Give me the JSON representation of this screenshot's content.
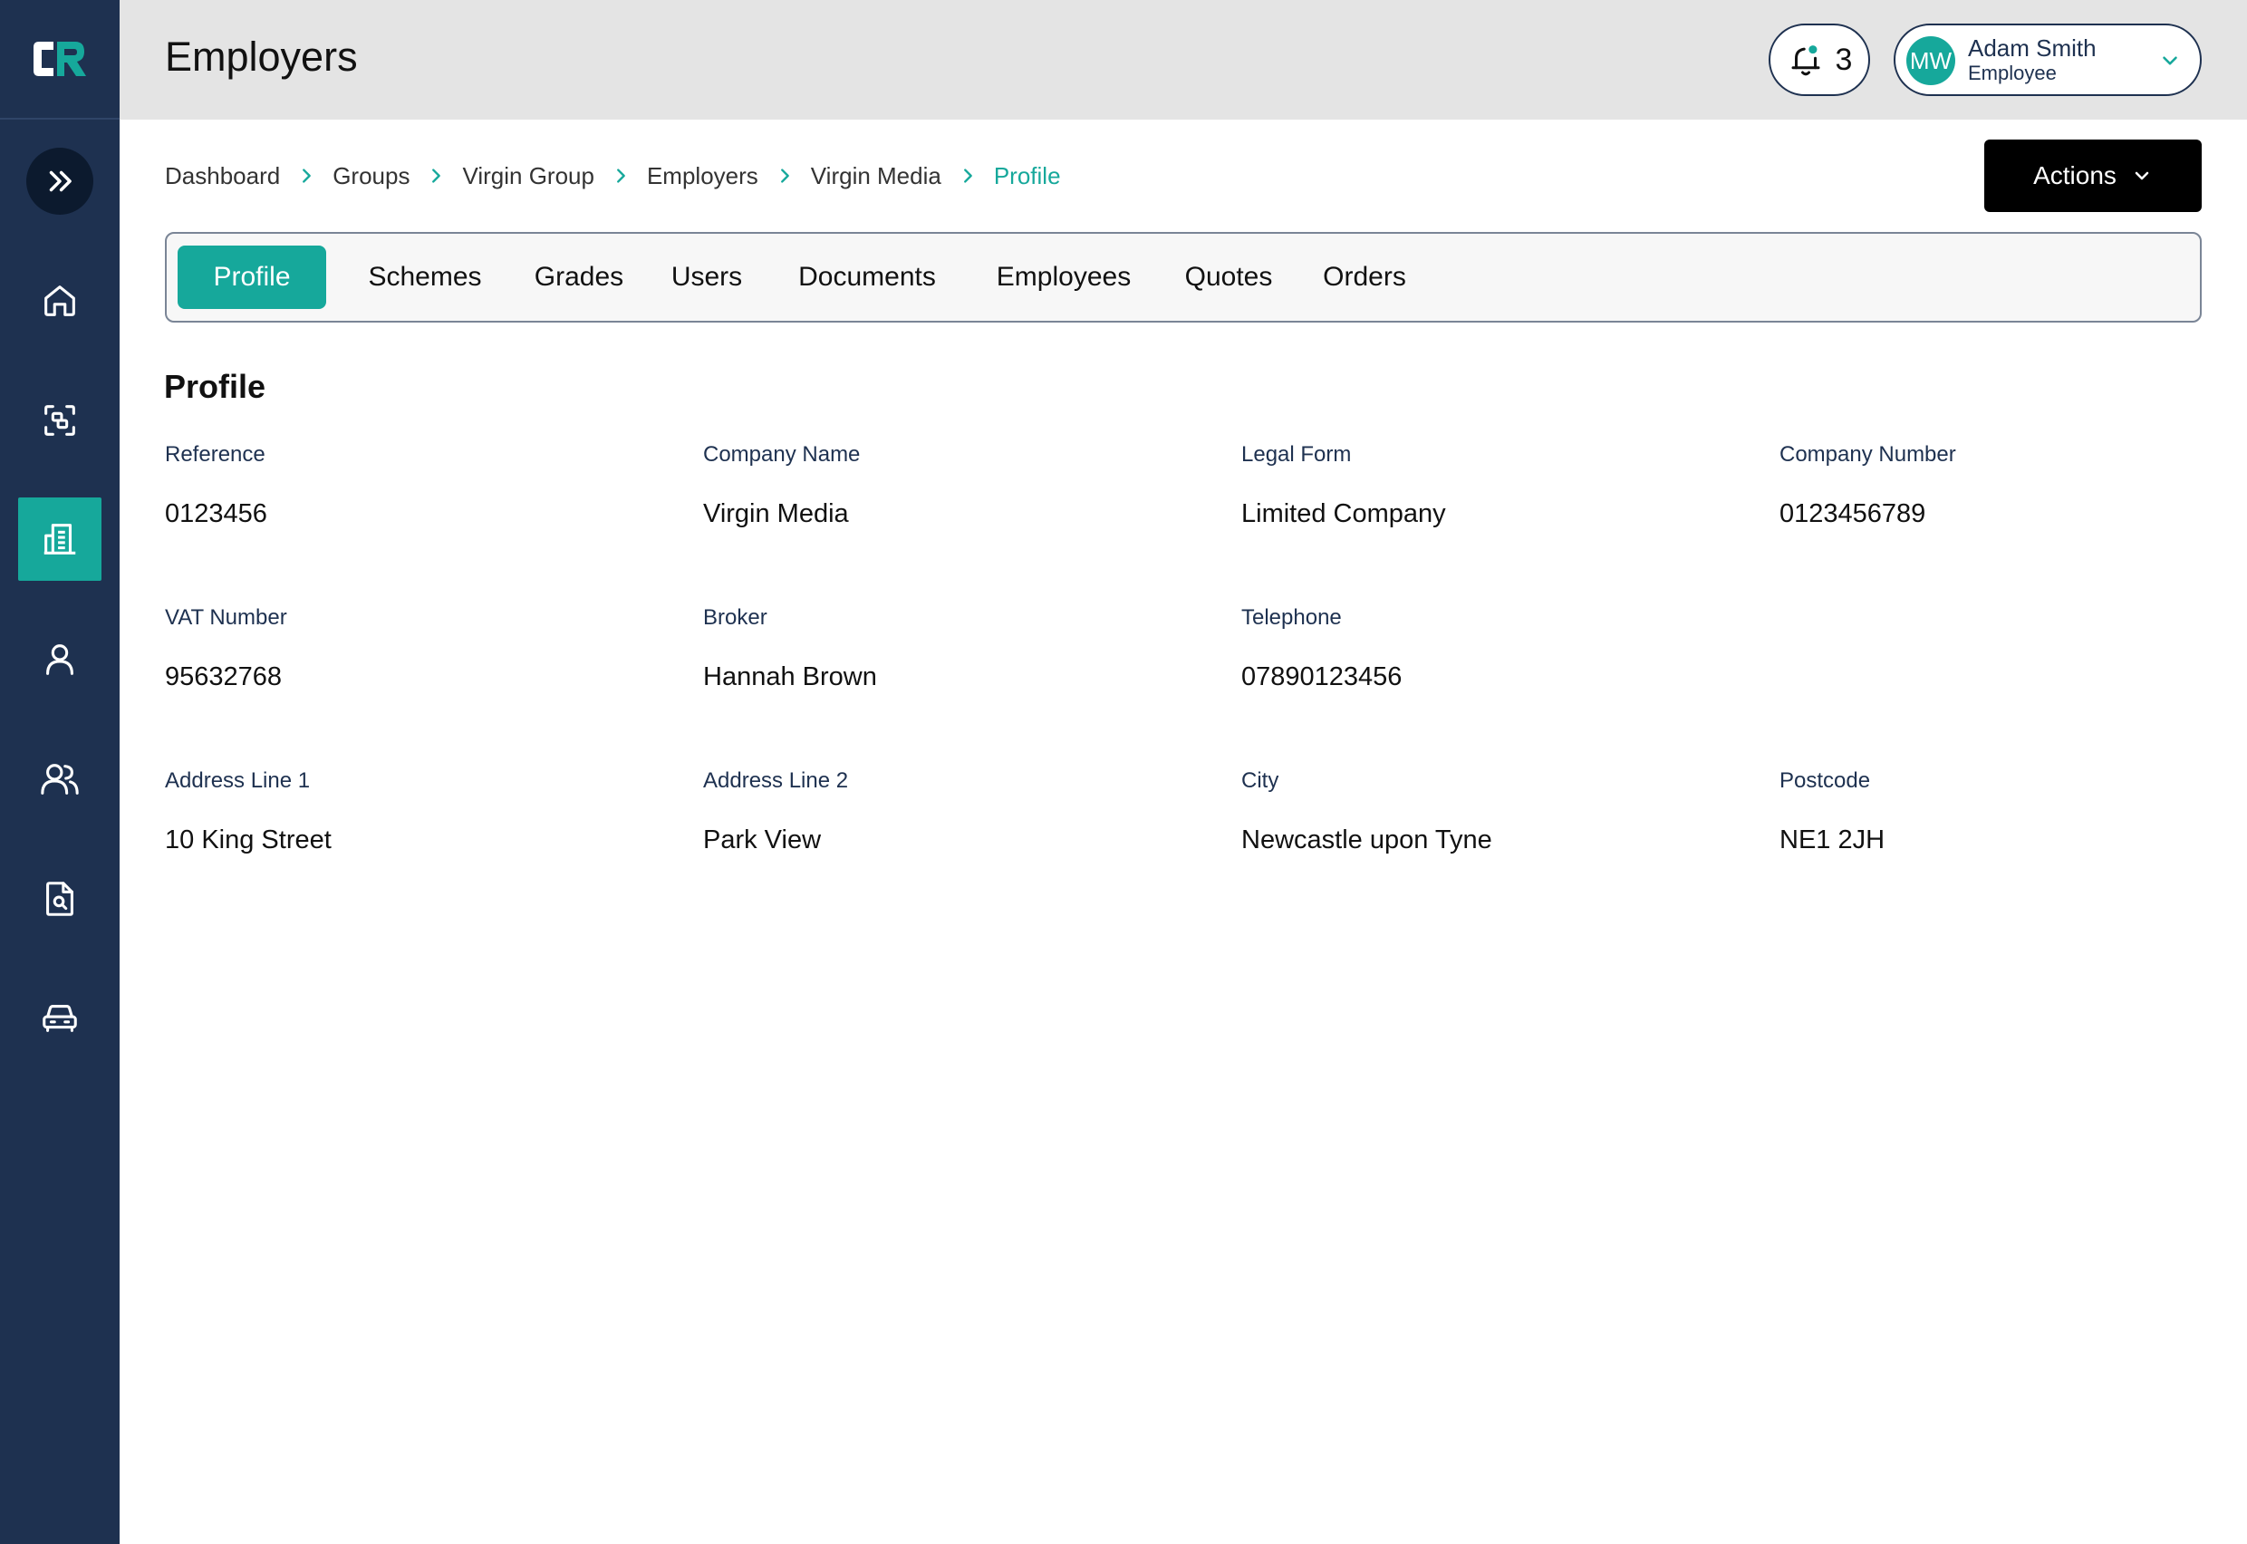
{
  "header": {
    "title": "Employers",
    "notifications": {
      "count": "3",
      "icon": "bell-icon"
    },
    "user": {
      "initials": "MW",
      "name": "Adam Smith",
      "role": "Employee"
    }
  },
  "sidebar": {
    "items": [
      {
        "name": "home",
        "icon": "home-icon",
        "active": false
      },
      {
        "name": "scan",
        "icon": "scan-icon",
        "active": false
      },
      {
        "name": "employers",
        "icon": "building-icon",
        "active": true
      },
      {
        "name": "user",
        "icon": "user-icon",
        "active": false
      },
      {
        "name": "users",
        "icon": "users-icon",
        "active": false
      },
      {
        "name": "documents",
        "icon": "document-search-icon",
        "active": false
      },
      {
        "name": "vehicles",
        "icon": "car-icon",
        "active": false
      }
    ]
  },
  "breadcrumb": [
    "Dashboard",
    "Groups",
    "Virgin Group",
    "Employers",
    "Virgin Media",
    "Profile"
  ],
  "actions_label": "Actions",
  "tabs": [
    "Profile",
    "Schemes",
    "Grades",
    "Users",
    "Documents",
    "Employees",
    "Quotes",
    "Orders"
  ],
  "profile": {
    "title": "Profile",
    "fields": [
      {
        "label": "Reference",
        "value": "0123456"
      },
      {
        "label": "Company Name",
        "value": "Virgin Media"
      },
      {
        "label": "Legal Form",
        "value": "Limited Company"
      },
      {
        "label": "Company Number",
        "value": "0123456789"
      },
      {
        "label": "VAT Number",
        "value": "95632768"
      },
      {
        "label": "Broker",
        "value": "Hannah Brown"
      },
      {
        "label": "Telephone",
        "value": "07890123456"
      },
      {
        "label": "Address Line 1",
        "value": "10 King Street"
      },
      {
        "label": "Address Line 2",
        "value": "Park View"
      },
      {
        "label": "City",
        "value": "Newcastle upon Tyne"
      },
      {
        "label": "Postcode",
        "value": "NE1 2JH"
      }
    ]
  },
  "colors": {
    "accent": "#16a89b",
    "sidebar": "#1e3150",
    "header": "#e4e4e4"
  }
}
